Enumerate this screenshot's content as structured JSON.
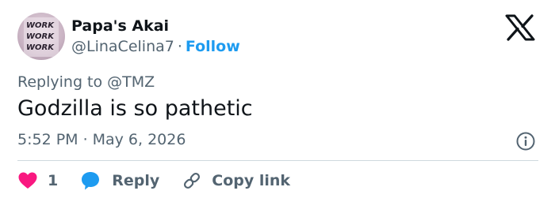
{
  "author": {
    "name": "Papa's Akai",
    "handle": "@LinaCelina7",
    "separator": "·",
    "follow_label": "Follow",
    "avatar_text": [
      "WORK",
      "WORK",
      "WORK"
    ]
  },
  "replying": {
    "prefix": "Replying to",
    "mention": "@TMZ"
  },
  "tweet": {
    "text": "Godzilla is so pathetic",
    "time": "5:52 PM",
    "separator": "·",
    "date": "May 6, 2026"
  },
  "actions": {
    "like_count": "1",
    "reply_label": "Reply",
    "copy_label": "Copy link"
  },
  "colors": {
    "accent": "#1d9bf0",
    "like": "#f91880",
    "muted": "#536471",
    "text": "#0f1419"
  },
  "icons": {
    "logo": "x-logo-icon",
    "info": "info-icon",
    "like": "heart-icon",
    "reply": "speech-bubble-icon",
    "copy": "link-icon"
  }
}
